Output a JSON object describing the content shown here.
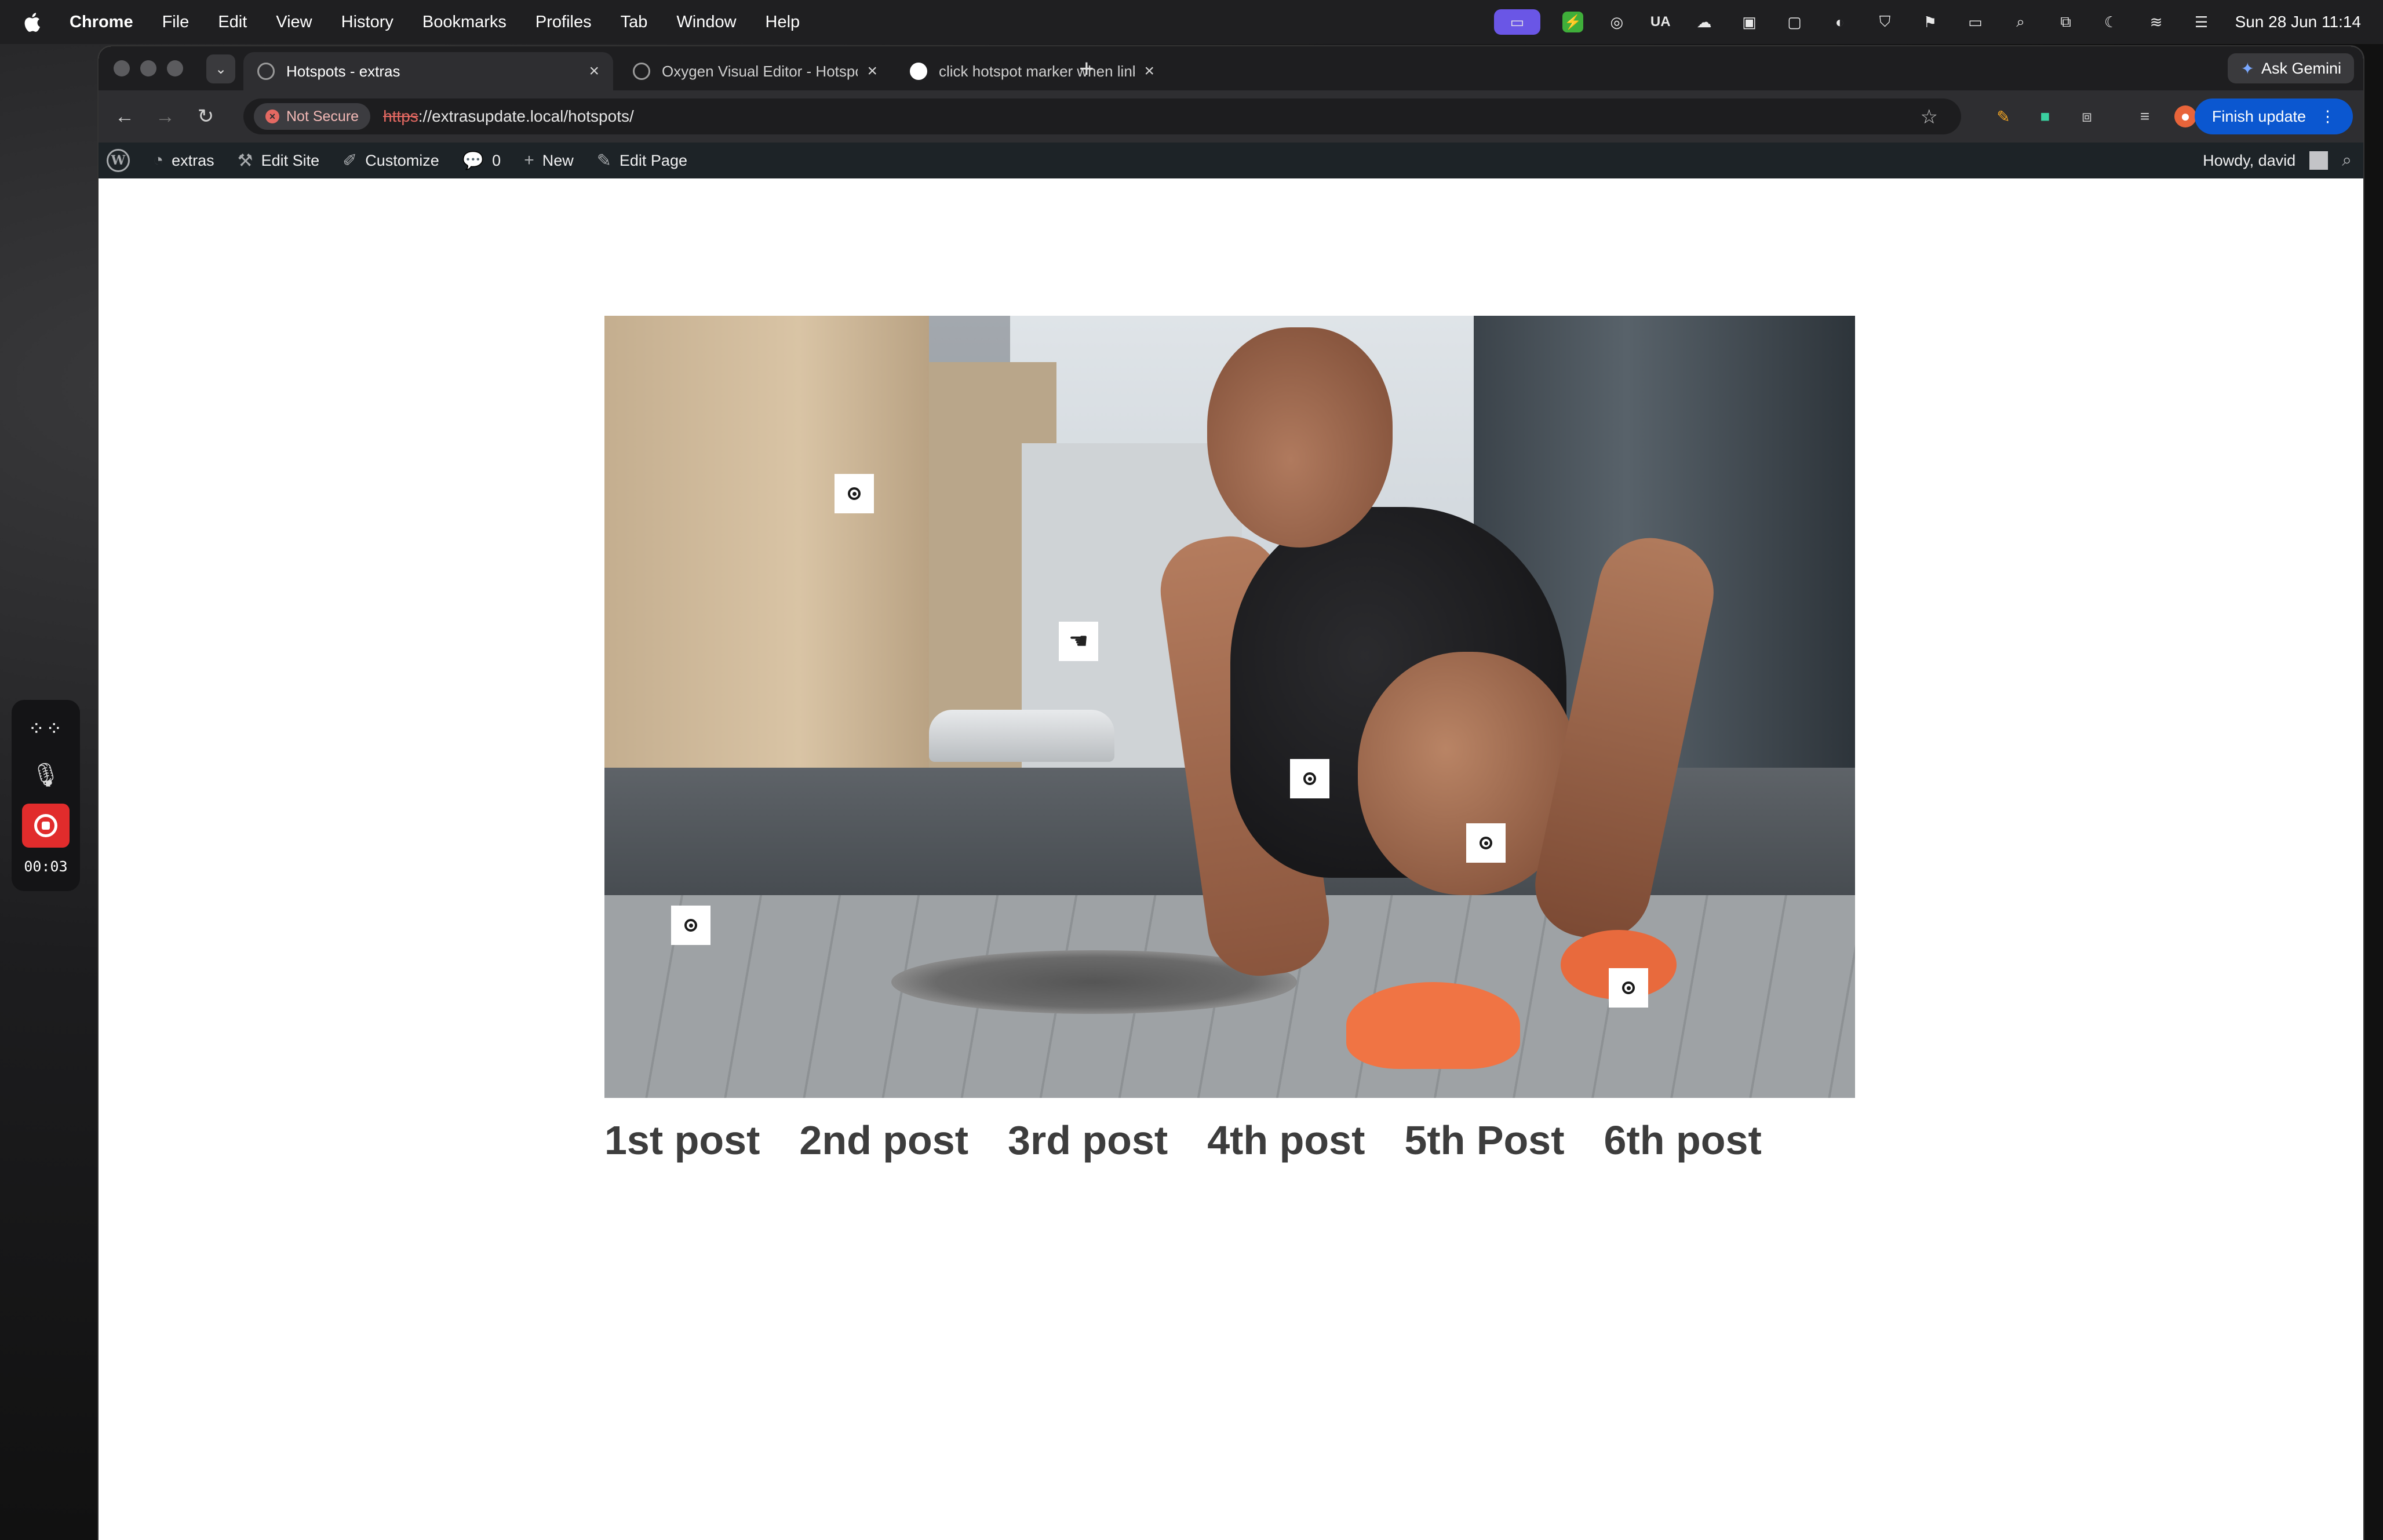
{
  "menubar": {
    "app_name": "Chrome",
    "items": [
      "File",
      "Edit",
      "View",
      "History",
      "Bookmarks",
      "Profiles",
      "Tab",
      "Window",
      "Help"
    ],
    "status_ua": "UA",
    "clock": "Sun 28 Jun  11:14"
  },
  "browser": {
    "tabs": [
      {
        "title": "Hotspots - extras",
        "active": true
      },
      {
        "title": "Oxygen Visual Editor - Hotspots",
        "active": false
      },
      {
        "title": "click hotspot marker when link",
        "active": false
      }
    ],
    "ask_gemini": "Ask Gemini",
    "security_label": "Not Secure",
    "url_scheme": "https",
    "url_rest": "://extrasupdate.local/hotspots/",
    "finish_update": "Finish update"
  },
  "wp_admin_bar": {
    "site_name": "extras",
    "edit_site": "Edit Site",
    "customize": "Customize",
    "comments_count": "0",
    "new": "New",
    "edit_page": "Edit Page",
    "howdy": "Howdy, david"
  },
  "page": {
    "posts": [
      "1st post",
      "2nd post",
      "3rd post",
      "4th post",
      "5th Post",
      "6th post"
    ]
  },
  "recorder": {
    "elapsed": "00:03"
  }
}
